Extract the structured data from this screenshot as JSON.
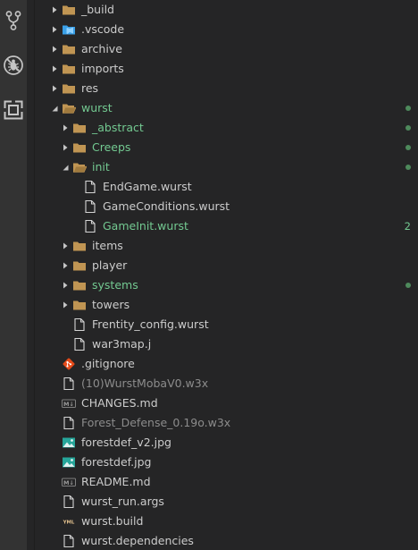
{
  "colors": {
    "background": "#252526",
    "activity_bar": "#333333",
    "text": "#cccccc",
    "modified": "#73c991",
    "ignored": "#8c8c8c"
  },
  "activity_bar": {
    "items": [
      {
        "icon": "source-control-icon"
      },
      {
        "icon": "no-bugs-icon"
      },
      {
        "icon": "extensions-icon"
      }
    ]
  },
  "tree": [
    {
      "label": "_build",
      "type": "folder",
      "depth": 0,
      "expanded": false,
      "icon": "folder-icon"
    },
    {
      "label": ".vscode",
      "type": "folder",
      "depth": 0,
      "expanded": false,
      "icon": "vscode-folder-icon"
    },
    {
      "label": "archive",
      "type": "folder",
      "depth": 0,
      "expanded": false,
      "icon": "folder-icon"
    },
    {
      "label": "imports",
      "type": "folder",
      "depth": 0,
      "expanded": false,
      "icon": "folder-icon"
    },
    {
      "label": "res",
      "type": "folder",
      "depth": 0,
      "expanded": false,
      "icon": "folder-icon"
    },
    {
      "label": "wurst",
      "type": "folder",
      "depth": 0,
      "expanded": true,
      "icon": "folder-open-icon",
      "status": "modified",
      "decoration": "dot"
    },
    {
      "label": "_abstract",
      "type": "folder",
      "depth": 1,
      "expanded": false,
      "icon": "folder-icon",
      "status": "modified",
      "decoration": "dot"
    },
    {
      "label": "Creeps",
      "type": "folder",
      "depth": 1,
      "expanded": false,
      "icon": "folder-icon",
      "status": "modified",
      "decoration": "dot"
    },
    {
      "label": "init",
      "type": "folder",
      "depth": 1,
      "expanded": true,
      "icon": "folder-open-icon",
      "status": "modified",
      "decoration": "dot"
    },
    {
      "label": "EndGame.wurst",
      "type": "file",
      "depth": 2,
      "icon": "file-icon"
    },
    {
      "label": "GameConditions.wurst",
      "type": "file",
      "depth": 2,
      "icon": "file-icon"
    },
    {
      "label": "GameInit.wurst",
      "type": "file",
      "depth": 2,
      "icon": "file-icon",
      "status": "modified",
      "decoration": "2"
    },
    {
      "label": "items",
      "type": "folder",
      "depth": 1,
      "expanded": false,
      "icon": "folder-icon"
    },
    {
      "label": "player",
      "type": "folder",
      "depth": 1,
      "expanded": false,
      "icon": "folder-icon"
    },
    {
      "label": "systems",
      "type": "folder",
      "depth": 1,
      "expanded": false,
      "icon": "folder-icon",
      "status": "modified",
      "decoration": "dot"
    },
    {
      "label": "towers",
      "type": "folder",
      "depth": 1,
      "expanded": false,
      "icon": "folder-icon"
    },
    {
      "label": "Frentity_config.wurst",
      "type": "file",
      "depth": 1,
      "icon": "file-icon"
    },
    {
      "label": "war3map.j",
      "type": "file",
      "depth": 1,
      "icon": "file-icon"
    },
    {
      "label": ".gitignore",
      "type": "file",
      "depth": 0,
      "icon": "git-icon"
    },
    {
      "label": "(10)WurstMobaV0.w3x",
      "type": "file",
      "depth": 0,
      "icon": "file-icon",
      "status": "ignored"
    },
    {
      "label": "CHANGES.md",
      "type": "file",
      "depth": 0,
      "icon": "markdown-icon"
    },
    {
      "label": "Forest_Defense_0.19o.w3x",
      "type": "file",
      "depth": 0,
      "icon": "file-icon",
      "status": "ignored"
    },
    {
      "label": "forestdef_v2.jpg",
      "type": "file",
      "depth": 0,
      "icon": "image-icon"
    },
    {
      "label": "forestdef.jpg",
      "type": "file",
      "depth": 0,
      "icon": "image-icon"
    },
    {
      "label": "README.md",
      "type": "file",
      "depth": 0,
      "icon": "markdown-icon"
    },
    {
      "label": "wurst_run.args",
      "type": "file",
      "depth": 0,
      "icon": "file-icon"
    },
    {
      "label": "wurst.build",
      "type": "file",
      "depth": 0,
      "icon": "yaml-icon"
    },
    {
      "label": "wurst.dependencies",
      "type": "file",
      "depth": 0,
      "icon": "file-icon"
    }
  ]
}
